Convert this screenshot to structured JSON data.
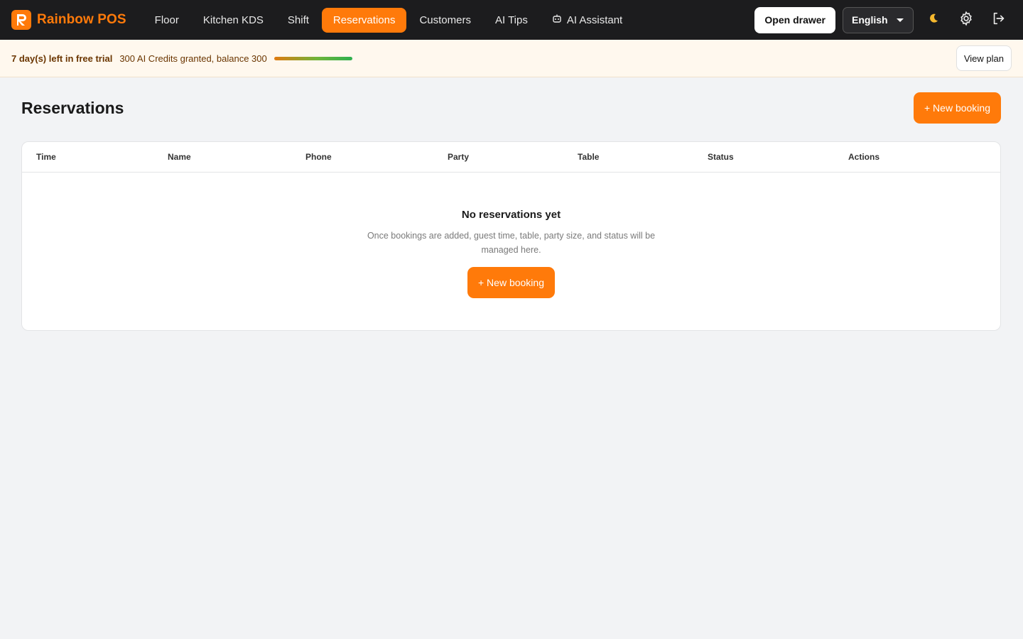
{
  "brand": {
    "name": "Rainbow POS"
  },
  "nav": {
    "items": [
      {
        "label": "Floor",
        "name": "nav-floor"
      },
      {
        "label": "Kitchen KDS",
        "name": "nav-kitchen-kds"
      },
      {
        "label": "Shift",
        "name": "nav-shift"
      },
      {
        "label": "Reservations",
        "name": "nav-reservations"
      },
      {
        "label": "Customers",
        "name": "nav-customers"
      },
      {
        "label": "AI Tips",
        "name": "nav-ai-tips"
      },
      {
        "label": "AI Assistant",
        "name": "nav-ai-assistant"
      }
    ],
    "active": "Reservations",
    "open_drawer": "Open drawer",
    "language": "English",
    "icons": {
      "theme": "moon-icon",
      "settings": "gear-icon",
      "logout": "logout-icon",
      "assistant": "robot-icon"
    }
  },
  "trial": {
    "days_left": "7 day(s) left in free trial",
    "credits": "300 AI Credits granted, balance 300",
    "credit_fraction": 1.0,
    "view_plan": "View plan"
  },
  "page": {
    "title": "Reservations",
    "new_booking": "+ New booking"
  },
  "table": {
    "columns": [
      "Time",
      "Name",
      "Phone",
      "Party",
      "Table",
      "Status",
      "Actions"
    ],
    "rows": []
  },
  "empty": {
    "title": "No reservations yet",
    "description": "Once bookings are added, guest time, table, party size, and status will be managed here.",
    "button": "+ New booking"
  },
  "colors": {
    "accent": "#ff7a0a",
    "topbar": "#1c1c1e",
    "background": "#f2f3f5"
  }
}
